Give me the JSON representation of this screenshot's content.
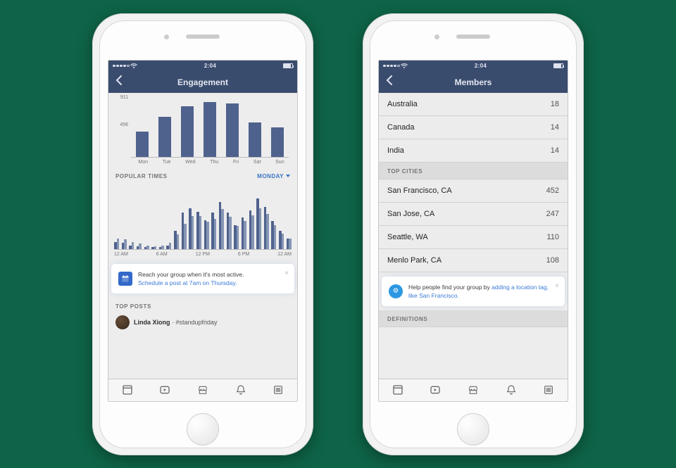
{
  "status": {
    "time": "2:04"
  },
  "left": {
    "nav_title": "Engagement",
    "chart_data": {
      "type": "bar",
      "categories": [
        "Mon",
        "Tue",
        "Wed",
        "Thu",
        "Fri",
        "Sat",
        "Sun"
      ],
      "values": [
        410,
        650,
        820,
        890,
        870,
        560,
        480
      ],
      "ylabel": "",
      "ylim": [
        0,
        911
      ],
      "yticks": [
        911,
        456
      ]
    },
    "popular_times": {
      "label": "POPULAR TIMES",
      "dropdown_label": "MONDAY",
      "xticks": [
        "12 AM",
        "6 AM",
        "12 PM",
        "6 PM",
        "12 AM"
      ],
      "chart_data": {
        "type": "bar",
        "x_hours": [
          0,
          1,
          2,
          3,
          4,
          5,
          6,
          7,
          8,
          9,
          10,
          11,
          12,
          13,
          14,
          15,
          16,
          17,
          18,
          19,
          20,
          21,
          22,
          23
        ],
        "series": [
          {
            "name": "selected_day",
            "values": [
              12,
              10,
              6,
              5,
              4,
              3,
              4,
              6,
              30,
              60,
              68,
              62,
              48,
              60,
              78,
              60,
              40,
              52,
              64,
              84,
              70,
              46,
              30,
              18
            ]
          },
          {
            "name": "week_avg",
            "values": [
              18,
              16,
              12,
              9,
              6,
              5,
              6,
              10,
              24,
              42,
              55,
              55,
              45,
              50,
              66,
              54,
              38,
              46,
              56,
              68,
              58,
              40,
              26,
              18
            ]
          }
        ],
        "ylim": [
          0,
          100
        ]
      }
    },
    "tip": {
      "line1": "Reach your group when it's most active.",
      "line2": "Schedule a post at 7am on Thursday."
    },
    "top_posts": {
      "label": "TOP POSTS",
      "first_post": {
        "author": "Linda Xiong",
        "hashtag": "#standupfriday"
      }
    }
  },
  "right": {
    "nav_title": "Members",
    "countries": [
      {
        "name": "Australia",
        "value": "18"
      },
      {
        "name": "Canada",
        "value": "14"
      },
      {
        "name": "India",
        "value": "14"
      }
    ],
    "top_cities_label": "TOP CITIES",
    "cities": [
      {
        "name": "San Francisco, CA",
        "value": "452"
      },
      {
        "name": "San Jose, CA",
        "value": "247"
      },
      {
        "name": "Seattle, WA",
        "value": "110"
      },
      {
        "name": "Menlo Park, CA",
        "value": "108"
      }
    ],
    "tip": {
      "line1": "Help people find your group by ",
      "link": "adding a location tag, like San Francisco."
    },
    "definitions_label": "DEFINITIONS"
  },
  "tabs": [
    "feed",
    "video",
    "marketplace",
    "notifications",
    "menu"
  ]
}
